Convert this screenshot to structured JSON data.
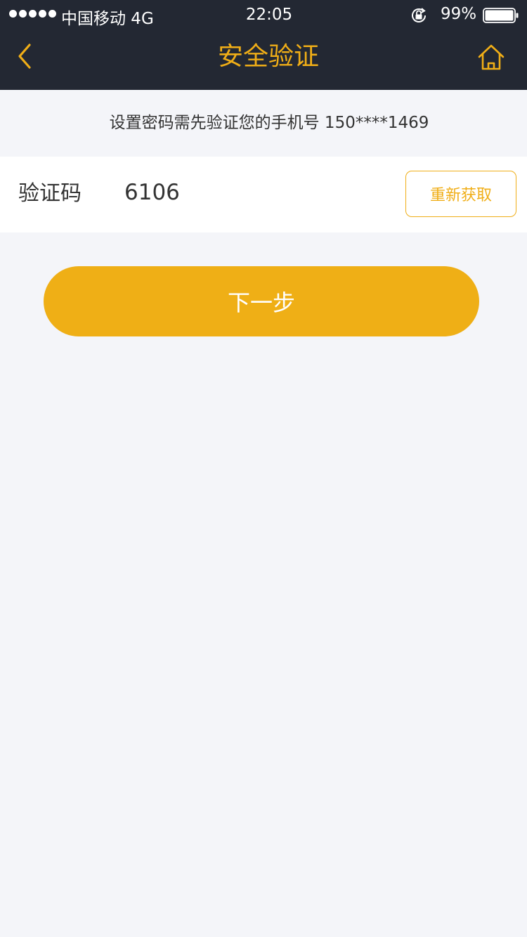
{
  "status_bar": {
    "carrier": "中国移动  4G",
    "time": "22:05",
    "battery": "99%",
    "signal_icon": "signal-dots-icon",
    "lock_icon": "rotation-lock-icon",
    "battery_icon": "battery-icon"
  },
  "nav": {
    "title": "安全验证",
    "back_icon": "chevron-left-icon",
    "home_icon": "home-icon"
  },
  "hint": "设置密码需先验证您的手机号 150****1469",
  "verification": {
    "label": "验证码",
    "value": "6106",
    "resend_label": "重新获取"
  },
  "next_button_label": "下一步",
  "colors": {
    "accent": "#f0ae17",
    "header_bg": "#232833",
    "page_bg": "#f4f5f9"
  }
}
